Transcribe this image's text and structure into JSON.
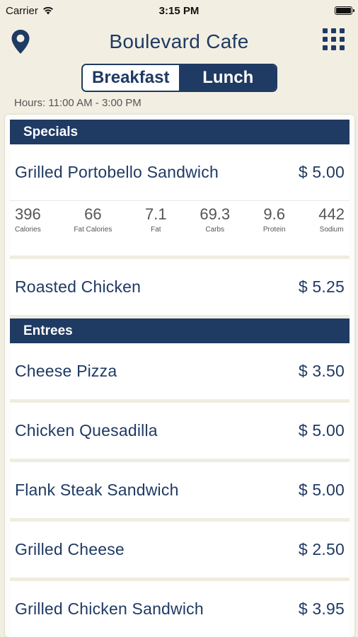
{
  "status_bar": {
    "carrier": "Carrier",
    "time": "3:15 PM",
    "battery_level_pct": 100
  },
  "header": {
    "title": "Boulevard Cafe",
    "left_icon": "location-pin-icon",
    "right_icon": "grid-menu-icon"
  },
  "meal_tabs": {
    "breakfast": "Breakfast",
    "lunch": "Lunch",
    "selected": "Lunch"
  },
  "hours": "Hours: 11:00 AM - 3:00 PM",
  "colors": {
    "primary": "#1f3a63",
    "background": "#f2efe2"
  },
  "sections": [
    {
      "title": "Specials",
      "items": [
        {
          "name": "Grilled Portobello Sandwich",
          "price": "$ 5.00",
          "nutrition": [
            {
              "value": "396",
              "label": "Calories"
            },
            {
              "value": "66",
              "label": "Fat Calories"
            },
            {
              "value": "7.1",
              "label": "Fat"
            },
            {
              "value": "69.3",
              "label": "Carbs"
            },
            {
              "value": "9.6",
              "label": "Protein"
            },
            {
              "value": "442",
              "label": "Sodium"
            }
          ]
        },
        {
          "name": "Roasted Chicken",
          "price": "$ 5.25"
        }
      ]
    },
    {
      "title": "Entrees",
      "items": [
        {
          "name": "Cheese Pizza",
          "price": "$ 3.50"
        },
        {
          "name": "Chicken Quesadilla",
          "price": "$ 5.00"
        },
        {
          "name": "Flank Steak Sandwich",
          "price": "$ 5.00"
        },
        {
          "name": "Grilled Cheese",
          "price": "$ 2.50"
        },
        {
          "name": "Grilled Chicken Sandwich",
          "price": "$ 3.95"
        }
      ]
    }
  ]
}
